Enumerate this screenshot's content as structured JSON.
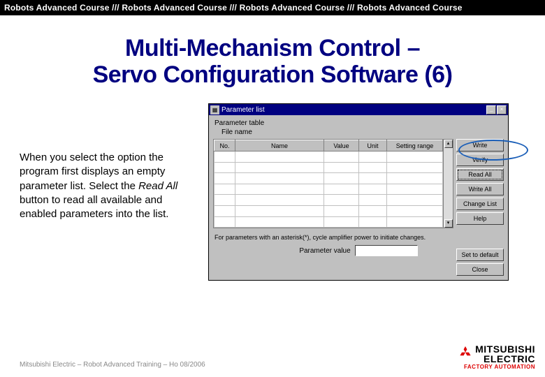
{
  "header": {
    "repeat_text": "Robots Advanced Course /// Robots Advanced Course /// Robots Advanced Course /// Robots Advanced Course"
  },
  "title": {
    "line1": "Multi-Mechanism Control –",
    "line2": "Servo Configuration Software (6)"
  },
  "explain": {
    "p1a": "When you select the option the program first displays an empty parameter list. Select the ",
    "p1b": "Read All",
    "p1c": " button to read all available and enabled parameters into the list."
  },
  "dialog": {
    "title": "Parameter list",
    "section_label": "Parameter table",
    "filename_label": "File name",
    "filename_value": "",
    "columns": [
      "No.",
      "Name",
      "Value",
      "Unit",
      "Setting range"
    ],
    "rows": 7,
    "buttons_side": [
      "Write",
      "Verify",
      "Read All",
      "Write All",
      "Change List",
      "Help"
    ],
    "highlight_button_index": 2,
    "note": "For parameters with an asterisk(*), cycle amplifier power to initiate changes.",
    "param_value_label": "Parameter value",
    "buttons_lower": [
      "Set to default",
      "Close"
    ],
    "win_min": "_",
    "win_close": "×",
    "win_icon": "▦"
  },
  "footer": {
    "text": "Mitsubishi Electric – Robot Advanced Training – Ho 08/2006"
  },
  "logo": {
    "brand_top": "MITSUBISHI",
    "brand_bottom": "ELECTRIC",
    "tagline": "FACTORY AUTOMATION"
  }
}
